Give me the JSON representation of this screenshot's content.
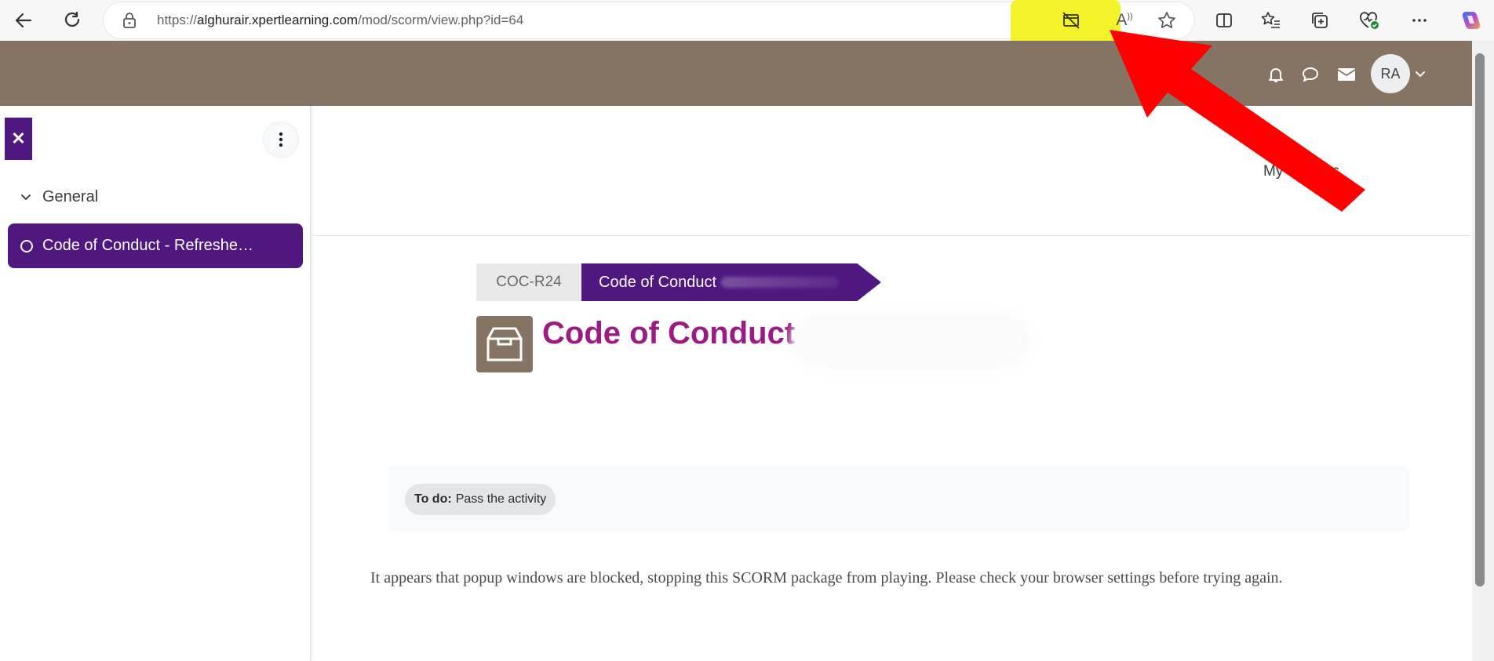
{
  "browser": {
    "url_prefix": "https://",
    "url_host": "alghurair.xpertlearning.com",
    "url_path": "/mod/scorm/view.php?id=64",
    "read_aloud_label": "A"
  },
  "header": {
    "avatar_initials": "RA"
  },
  "drawer": {
    "section_label": "General",
    "active_item_label": "Code of Conduct - Refreshe…"
  },
  "main": {
    "my_courses_link": "My courses",
    "breadcrumb": {
      "course_code": "COC-R24",
      "current": "Code of Conduct"
    },
    "page_title": "Code of Conduct",
    "todo": {
      "prefix": "To do:",
      "text": "Pass the activity"
    },
    "message": "It appears that popup windows are blocked, stopping this SCORM package from playing. Please check your browser settings before trying again."
  },
  "colors": {
    "header": "#857463",
    "brand_purple": "#4f1880",
    "title_magenta": "#9b1a83",
    "highlight": "#f2f21a",
    "annotation_arrow": "#ff0000"
  },
  "icons": [
    "back-icon",
    "reload-icon",
    "lock-icon",
    "popup-blocked-icon",
    "read-aloud-icon",
    "favorite-star-icon",
    "split-screen-icon",
    "favorites-list-icon",
    "collections-icon",
    "browser-essentials-icon",
    "more-icon",
    "copilot-icon",
    "bell-icon",
    "chat-icon",
    "mail-icon",
    "chevron-down-icon",
    "close-icon",
    "kebab-icon",
    "box-icon"
  ]
}
